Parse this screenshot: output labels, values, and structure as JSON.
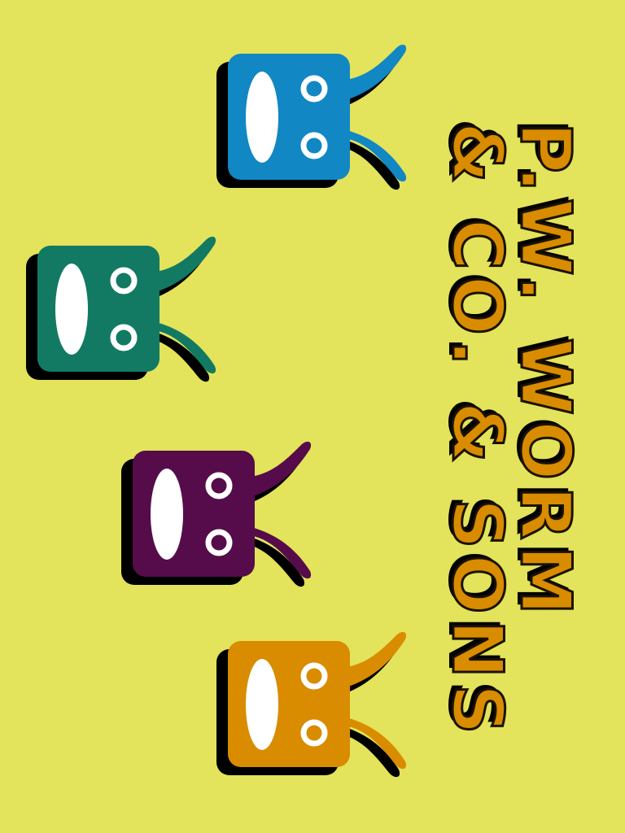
{
  "title": {
    "line1": "P.W. WORM",
    "line2": "& CO. & SONS"
  },
  "colors": {
    "background": "#e3e35c",
    "title_fill": "#d98c00",
    "outline": "#000000"
  },
  "worms": [
    {
      "name": "blue-worm",
      "color": "#1187c4"
    },
    {
      "name": "green-worm",
      "color": "#127a62"
    },
    {
      "name": "purple-worm",
      "color": "#560c4a"
    },
    {
      "name": "orange-worm",
      "color": "#d98c00"
    }
  ]
}
